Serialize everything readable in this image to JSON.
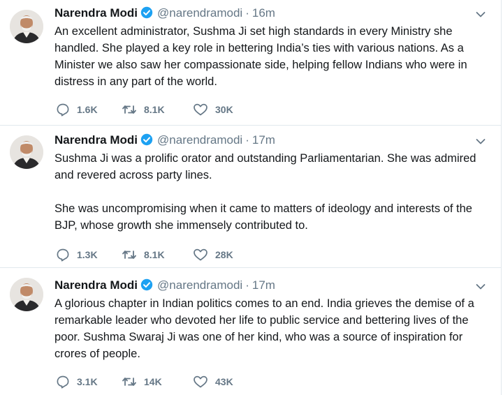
{
  "author": {
    "name": "Narendra Modi",
    "handle": "@narendramodi"
  },
  "tweets": [
    {
      "time": "16m",
      "paragraphs": [
        "An excellent administrator, Sushma Ji set high standards in every Ministry she handled. She played a key role in bettering India’s ties with various nations. As a Minister we also saw her compassionate side, helping fellow Indians who were in distress in any part of the world."
      ],
      "replies": "1.6K",
      "retweets": "8.1K",
      "likes": "30K"
    },
    {
      "time": "17m",
      "paragraphs": [
        "Sushma Ji was a prolific orator and outstanding Parliamentarian. She was admired and revered across party lines.",
        "She was uncompromising when it came to matters of ideology and interests of the BJP, whose growth she immensely contributed to."
      ],
      "replies": "1.3K",
      "retweets": "8.1K",
      "likes": "28K"
    },
    {
      "time": "17m",
      "paragraphs": [
        "A glorious chapter in Indian politics comes to an end. India grieves the demise of a remarkable leader who devoted her life to public service and bettering lives of the poor. Sushma Swaraj Ji was one of her kind, who was a source of inspiration for crores of people."
      ],
      "replies": "3.1K",
      "retweets": "14K",
      "likes": "43K"
    }
  ],
  "ui": {
    "separator": "·",
    "icons": {
      "reply": "reply-icon",
      "retweet": "retweet-icon",
      "like": "heart-icon",
      "verified": "verified-badge-icon",
      "menu": "chevron-down-icon"
    },
    "colors": {
      "text": "#14171a",
      "secondary": "#657786",
      "verified": "#1da1f2",
      "divider": "#e1e8ed"
    }
  }
}
